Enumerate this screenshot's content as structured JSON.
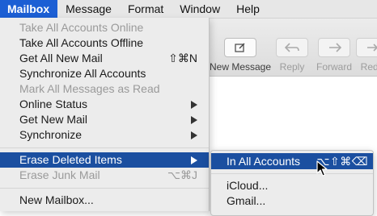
{
  "menubar": {
    "items": [
      "Mailbox",
      "Message",
      "Format",
      "Window",
      "Help"
    ]
  },
  "toolbar": {
    "new_message": "New Message",
    "reply": "Reply",
    "forward": "Forward",
    "redirect": "Redir"
  },
  "mailbox_menu": {
    "items": [
      {
        "label": "Take All Accounts Online",
        "shortcut": "",
        "enabled": false
      },
      {
        "label": "Take All Accounts Offline",
        "shortcut": "",
        "enabled": true
      },
      {
        "label": "Get All New Mail",
        "shortcut": "⇧⌘N",
        "enabled": true
      },
      {
        "label": "Synchronize All Accounts",
        "shortcut": "",
        "enabled": true
      },
      {
        "label": "Mark All Messages as Read",
        "shortcut": "",
        "enabled": false
      },
      {
        "label": "Online Status",
        "shortcut": "",
        "enabled": true
      },
      {
        "label": "Get New Mail",
        "shortcut": "",
        "enabled": true
      },
      {
        "label": "Synchronize",
        "shortcut": "",
        "enabled": true
      },
      {
        "label": "Erase Deleted Items",
        "shortcut": "",
        "enabled": true
      },
      {
        "label": "Erase Junk Mail",
        "shortcut": "⌥⌘J",
        "enabled": false
      },
      {
        "label": "New Mailbox...",
        "shortcut": "",
        "enabled": true
      }
    ]
  },
  "erase_submenu": {
    "items": [
      {
        "label": "In All Accounts",
        "shortcut": "⌥⇧⌘⌫"
      },
      {
        "label": "iCloud..."
      },
      {
        "label": "Gmail..."
      }
    ]
  },
  "colors": {
    "highlight": "#1b4fa0",
    "active_menu": "#1c5fd4",
    "disabled_text": "#9a9a9a"
  }
}
